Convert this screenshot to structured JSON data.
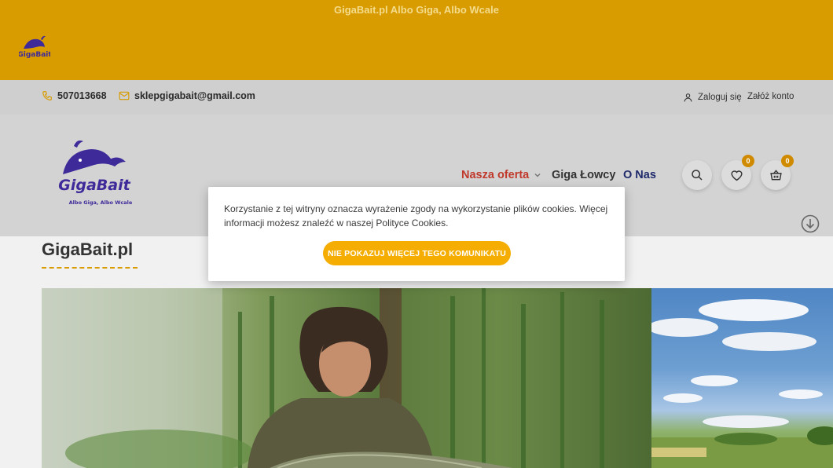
{
  "topbar": {
    "slogan": "GigaBait.pl Albo Giga, Albo Wcale",
    "logo_text": "GigaBait"
  },
  "contact": {
    "phone": "507013668",
    "email": "sklepgigabait@gmail.com",
    "login": "Zaloguj się",
    "register": "Załóż konto"
  },
  "header": {
    "logo_text": "GigaBait",
    "logo_tagline": "Albo Giga, Albo Wcale",
    "nav": {
      "offer": "Nasza oferta",
      "hunters": "Giga Łowcy",
      "about": "O Nas"
    },
    "wishlist_count": "0",
    "cart_count": "0"
  },
  "page": {
    "title": "GigaBait.pl"
  },
  "cookie": {
    "text": "Korzystanie z tej witryny oznacza wyrażenie zgody na wykorzystanie plików cookies. Więcej informacji możesz znaleźć w naszej Polityce Cookies.",
    "button": "NIE POKAZUJ WIĘCEJ TEGO KOMUNIKATU"
  },
  "colors": {
    "brand_orange": "#d89b00",
    "button_orange": "#f4ad00",
    "nav_active": "#c0392b",
    "nav_blue": "#1f2a6b",
    "logo_purple": "#3f2a9a"
  }
}
